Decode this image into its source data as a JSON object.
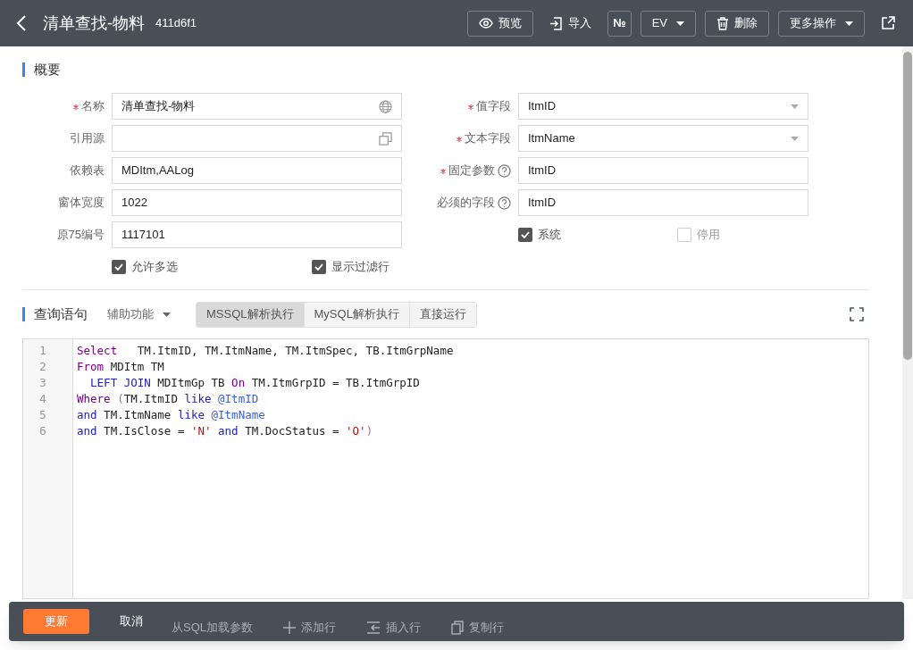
{
  "header": {
    "title": "清单查找-物料",
    "id": "411d6f1",
    "actions": [
      {
        "kind": "preview",
        "label": "预览"
      },
      {
        "kind": "import",
        "label": "导入"
      },
      {
        "kind": "glyph",
        "label": "№"
      },
      {
        "kind": "dropdown",
        "label": "EV"
      },
      {
        "kind": "delete",
        "label": "删除"
      },
      {
        "kind": "dropdown",
        "label": "更多操作"
      }
    ]
  },
  "overview": {
    "title": "概要",
    "left_fields": [
      {
        "kind": "localized",
        "label": "名称",
        "required": true,
        "help": false,
        "value": "清单查找-物料"
      },
      {
        "kind": "lookup",
        "label": "引用源",
        "required": false,
        "help": false
      },
      {
        "kind": "text",
        "label": "依赖表",
        "required": false,
        "help": false,
        "value": "MDItm,AALog"
      },
      {
        "kind": "text",
        "label": "窗体宽度",
        "required": false,
        "help": false,
        "value": "1022"
      },
      {
        "kind": "text",
        "label": "原75编号",
        "required": false,
        "help": false,
        "value": "1117101"
      }
    ],
    "right_fields": [
      {
        "kind": "select",
        "label": "值字段",
        "required": true,
        "help": false,
        "value": "ItmID"
      },
      {
        "kind": "select",
        "label": "文本字段",
        "required": true,
        "help": false,
        "value": "ItmName"
      },
      {
        "kind": "text",
        "label": "固定参数",
        "required": true,
        "help": true,
        "value": "ItmID"
      },
      {
        "kind": "text",
        "label": "必须的字段",
        "required": false,
        "help": true,
        "value": "ItmID"
      }
    ],
    "left_checks": [
      {
        "label": "允许多选",
        "checked": true
      },
      {
        "label": "显示过滤行",
        "checked": true
      }
    ],
    "right_checks": [
      {
        "label": "系统",
        "checked": true
      },
      {
        "label": "停用",
        "checked": false
      }
    ]
  },
  "query": {
    "title": "查询语句",
    "helper": "辅助功能",
    "modes": [
      {
        "label": "MSSQL解析执行",
        "selected": true
      },
      {
        "label": "MySQL解析执行",
        "selected": false
      },
      {
        "label": "直接运行",
        "selected": false
      }
    ],
    "lines": [
      {
        "number": "1",
        "tokens": [
          {
            "kind": "keyword",
            "text": "Select"
          },
          {
            "kind": "plain",
            "text": "   TM.ItmID, TM.ItmName, TM.ItmSpec, TB.ItmGrpName"
          }
        ]
      },
      {
        "number": "2",
        "tokens": [
          {
            "kind": "keyword",
            "text": "From"
          },
          {
            "kind": "plain",
            "text": " MDItm TM"
          }
        ]
      },
      {
        "number": "3",
        "tokens": [
          {
            "kind": "operator",
            "text": "  LEFT JOIN"
          },
          {
            "kind": "plain",
            "text": " MDItmGp TB "
          },
          {
            "kind": "keyword",
            "text": "On"
          },
          {
            "kind": "plain",
            "text": " TM.ItmGrpID = TB.ItmGrpID"
          }
        ]
      },
      {
        "number": "4",
        "tokens": [
          {
            "kind": "keyword",
            "text": "Where"
          },
          {
            "kind": "paren",
            "text": " ("
          },
          {
            "kind": "plain",
            "text": "TM.ItmID "
          },
          {
            "kind": "operator",
            "text": "like"
          },
          {
            "kind": "variable",
            "text": " @ItmID"
          }
        ]
      },
      {
        "number": "5",
        "tokens": [
          {
            "kind": "operator",
            "text": "and"
          },
          {
            "kind": "plain",
            "text": " TM.ItmName "
          },
          {
            "kind": "operator",
            "text": "like"
          },
          {
            "kind": "variable",
            "text": " @ItmName"
          }
        ]
      },
      {
        "number": "6",
        "tokens": [
          {
            "kind": "operator",
            "text": "and"
          },
          {
            "kind": "plain",
            "text": " TM.IsClose = "
          },
          {
            "kind": "string",
            "text": "'N'"
          },
          {
            "kind": "operator",
            "text": " and"
          },
          {
            "kind": "plain",
            "text": " TM.DocStatus = "
          },
          {
            "kind": "string",
            "text": "'O'"
          },
          {
            "kind": "paren",
            "text": ")"
          }
        ]
      }
    ]
  },
  "toolbar": [
    {
      "kind": "load",
      "label": "从SQL加载参数"
    },
    {
      "kind": "add",
      "label": "添加行"
    },
    {
      "kind": "insert",
      "label": "插入行"
    },
    {
      "kind": "copy",
      "label": "复制行"
    }
  ],
  "footer": {
    "primary": "更新",
    "secondary": "取消"
  }
}
